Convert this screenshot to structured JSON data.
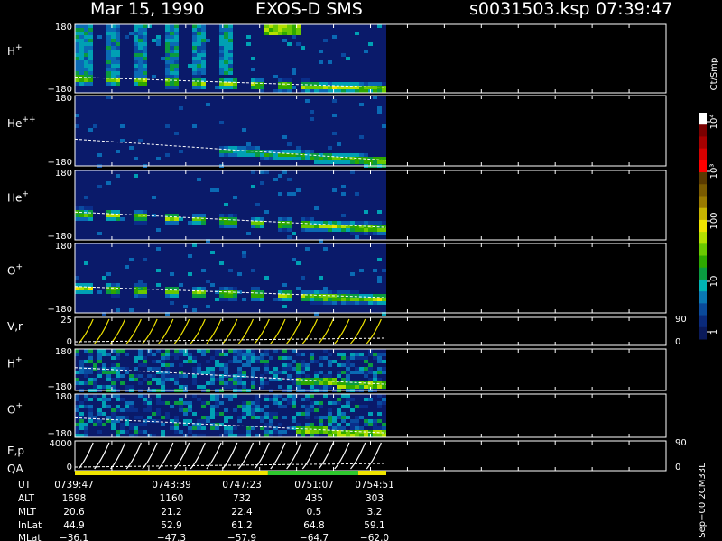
{
  "header": {
    "date": "Mar 15, 1990",
    "instrument": "EXOS-D SMS",
    "file": "s0031503.ksp",
    "time": "07:39:47"
  },
  "colorbar": {
    "unit": "Ct/Smp",
    "ticks": [
      "10⁴",
      "10³",
      "100",
      "10",
      "1"
    ],
    "colors": [
      "#ffffff",
      "#7a0000",
      "#a50000",
      "#d40000",
      "#ff0000",
      "#5a3a00",
      "#7a5a00",
      "#9a7a00",
      "#c8b400",
      "#f0e400",
      "#b4e000",
      "#6ac800",
      "#2ea800",
      "#0a9a40",
      "#00b4b4",
      "#0a78b4",
      "#0a4a9a",
      "#0a2a7a",
      "#0a1a5a"
    ]
  },
  "chart_data": [
    {
      "type": "heatmap",
      "panel": "H+",
      "label": "H",
      "sup": "+",
      "ymax": "180",
      "ymin": "−180",
      "style": "banded",
      "trend": [
        0.77,
        0.92
      ]
    },
    {
      "type": "heatmap",
      "panel": "He++",
      "label": "He",
      "sup": "++",
      "ymax": "180",
      "ymin": "−180",
      "style": "weak",
      "trend": [
        0.62,
        0.92
      ]
    },
    {
      "type": "heatmap",
      "panel": "He+",
      "label": "He",
      "sup": "+",
      "ymax": "180",
      "ymin": "−180",
      "style": "banded",
      "trend": [
        0.6,
        0.82
      ]
    },
    {
      "type": "heatmap",
      "panel": "O+",
      "label": "O",
      "sup": "+",
      "ymax": "180",
      "ymin": "−180",
      "style": "banded",
      "trend": [
        0.62,
        0.78
      ]
    },
    {
      "type": "line",
      "panel": "V,r",
      "label": "V,r",
      "ymax": "25",
      "ymin": "0",
      "right_top": "90",
      "right_bottom": "0"
    },
    {
      "type": "heatmap",
      "panel": "H+ (2)",
      "label": "H",
      "sup": "+",
      "ymax": "180",
      "ymin": "−180",
      "style": "noisy",
      "trend": [
        0.45,
        0.85
      ]
    },
    {
      "type": "heatmap",
      "panel": "O+ (2)",
      "label": "O",
      "sup": "+",
      "ymax": "180",
      "ymin": "−180",
      "style": "noisy",
      "trend": [
        0.55,
        0.9
      ]
    },
    {
      "type": "line",
      "panel": "E,p",
      "label": "E,p",
      "ymax": "4000",
      "ymin": "0",
      "right_top": "90",
      "right_bottom": "0"
    }
  ],
  "qa": {
    "label": "QA",
    "segments": [
      {
        "from": 0.0,
        "to": 0.62,
        "color": "#f0e400"
      },
      {
        "from": 0.62,
        "to": 0.91,
        "color": "#2ec82e"
      },
      {
        "from": 0.91,
        "to": 1.0,
        "color": "#f0e400"
      }
    ]
  },
  "ephemeris": {
    "row_labels": [
      "UT",
      "ALT",
      "MLT",
      "InLat",
      "MLat"
    ],
    "columns": [
      [
        "0739:47",
        "1698",
        "20.6",
        "44.9",
        "−36.1"
      ],
      [
        "0743:39",
        "1160",
        "21.2",
        "52.9",
        "−47.3"
      ],
      [
        "0747:23",
        "732",
        "22.4",
        "61.2",
        "−57.9"
      ],
      [
        "0751:07",
        "435",
        "0.5",
        "64.8",
        "−64.7"
      ],
      [
        "0754:51",
        "303",
        "3.2",
        "59.1",
        "−62.0"
      ]
    ]
  },
  "footer": "Sep−00 2CM33L"
}
